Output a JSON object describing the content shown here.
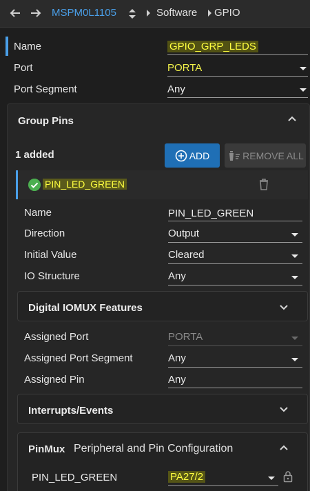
{
  "toolbar": {
    "device": "MSPM0L1105",
    "crumb1": "Software",
    "crumb2": "GPIO"
  },
  "main": {
    "name_label": "Name",
    "name_value": "GPIO_GRP_LEDS",
    "port_label": "Port",
    "port_value": "PORTA",
    "segment_label": "Port Segment",
    "segment_value": "Any"
  },
  "group": {
    "title": "Group Pins",
    "added": "1 added",
    "add_label": "ADD",
    "remove_label": "REMOVE ALL",
    "pin": {
      "name": "PIN_LED_GREEN"
    },
    "fields": {
      "name_label": "Name",
      "name_value": "PIN_LED_GREEN",
      "direction_label": "Direction",
      "direction_value": "Output",
      "initial_label": "Initial Value",
      "initial_value": "Cleared",
      "io_label": "IO Structure",
      "io_value": "Any"
    },
    "iomux_title": "Digital IOMUX Features",
    "assigned": {
      "port_label": "Assigned Port",
      "port_value": "PORTA",
      "segment_label": "Assigned Port Segment",
      "segment_value": "Any",
      "pin_label": "Assigned Pin",
      "pin_value": "Any"
    },
    "interrupts_title": "Interrupts/Events",
    "pinmux": {
      "title": "PinMux",
      "subtitle": "Peripheral and Pin Configuration",
      "pin_label": "PIN_LED_GREEN",
      "pin_value": "PA27/2"
    }
  },
  "colors": {
    "accent": "#1f6fb5",
    "link": "#4a9fe8",
    "highlight": "#ffff40",
    "success": "#4caf50"
  }
}
